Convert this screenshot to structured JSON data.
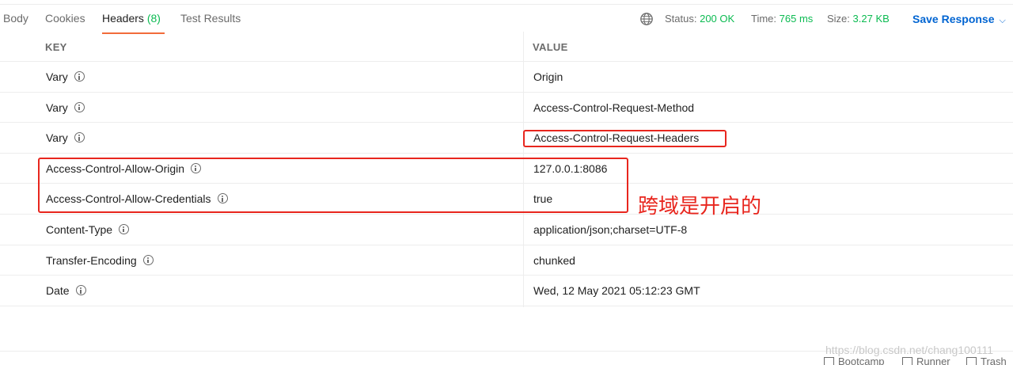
{
  "tabs": [
    {
      "label": "Body"
    },
    {
      "label": "Cookies"
    },
    {
      "label": "Headers",
      "count": "(8)"
    },
    {
      "label": "Test Results"
    }
  ],
  "status": {
    "status_label": "Status:",
    "status_value": "200 OK",
    "time_label": "Time:",
    "time_value": "765 ms",
    "size_label": "Size:",
    "size_value": "3.27 KB"
  },
  "save_response": "Save Response",
  "table": {
    "key_header": "KEY",
    "value_header": "VALUE",
    "rows": [
      {
        "key": "Vary",
        "value": "Origin"
      },
      {
        "key": "Vary",
        "value": "Access-Control-Request-Method"
      },
      {
        "key": "Vary",
        "value": "Access-Control-Request-Headers"
      },
      {
        "key": "Access-Control-Allow-Origin",
        "value": "127.0.0.1:8086"
      },
      {
        "key": "Access-Control-Allow-Credentials",
        "value": "true"
      },
      {
        "key": "Content-Type",
        "value": "application/json;charset=UTF-8"
      },
      {
        "key": "Transfer-Encoding",
        "value": "chunked"
      },
      {
        "key": "Date",
        "value": "Wed, 12 May 2021 05:12:23 GMT"
      }
    ]
  },
  "annotation": "跨域是开启的",
  "watermark": "https://blog.csdn.net/chang100111",
  "footer": {
    "bootcamp": "Bootcamp",
    "runner": "Runner",
    "trash": "Trash"
  },
  "colors": {
    "accent_green": "#0cbb52",
    "tab_underline": "#f26b3a",
    "link_blue": "#0265d2",
    "annotation_red": "#e8261e"
  }
}
